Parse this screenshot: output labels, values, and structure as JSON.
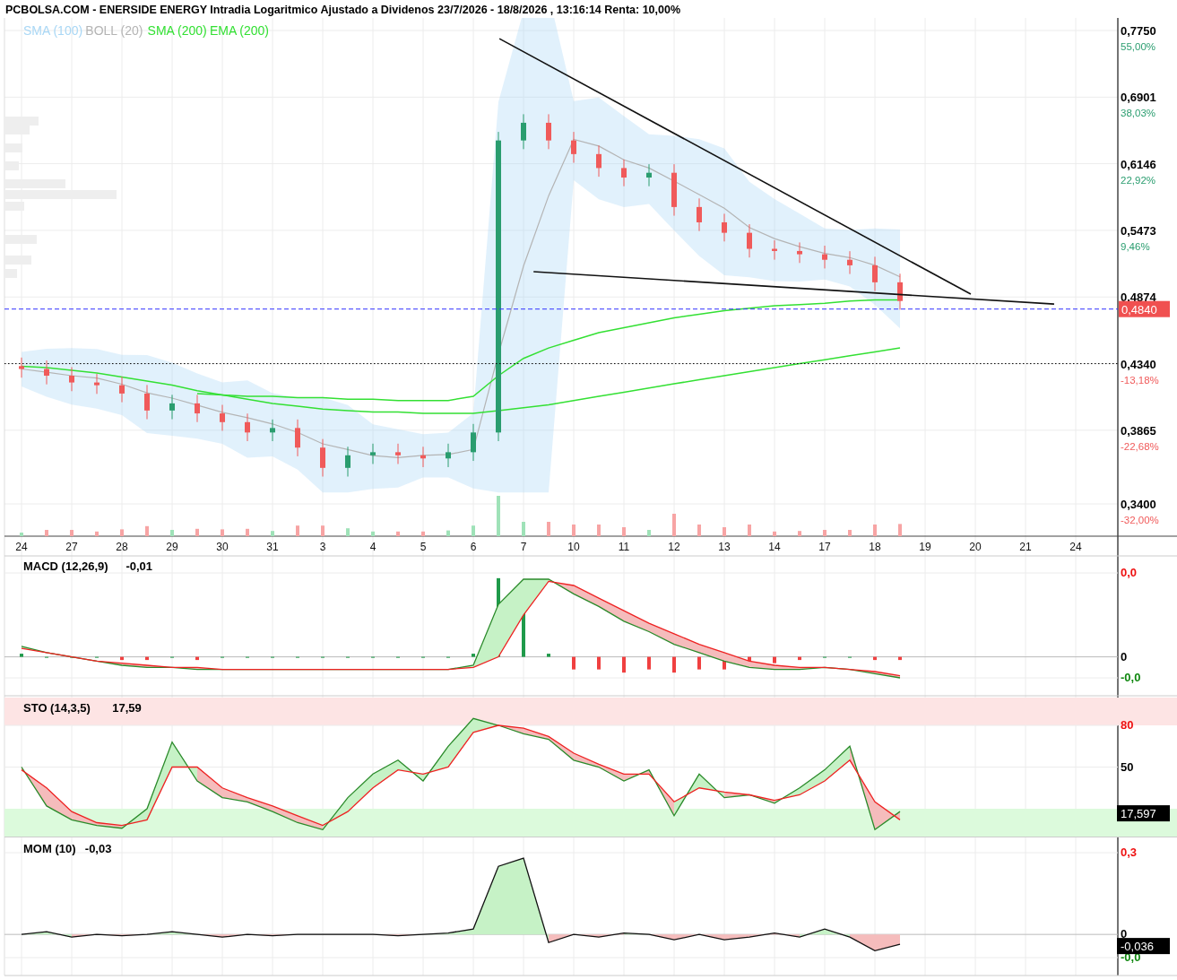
{
  "header": {
    "title": "PCBOLSA.COM - ENERSIDE ENERGY Intradia Logaritmico Ajustado a Dividenos 23/7/2026 - 18/8/2026 , 13:16:14 Renta: 10,00%"
  },
  "legend": [
    {
      "label": "SMA (100)",
      "color": "#a9d7f5"
    },
    {
      "label": "BOLL (20)",
      "color": "#b4b4b4"
    },
    {
      "label": "SMA (200)",
      "color": "#33e033"
    },
    {
      "label": "EMA (200)",
      "color": "#33e033"
    }
  ],
  "price_axis": {
    "labels": [
      "0,7750",
      "0,6901",
      "0,6146",
      "0,5473",
      "0,4874",
      "0,4340",
      "0,3865",
      "0,3400"
    ],
    "changes": [
      {
        "text": "55,00%",
        "kind": "up"
      },
      {
        "text": "38,03%",
        "kind": "up"
      },
      {
        "text": "22,92%",
        "kind": "up"
      },
      {
        "text": "9,46%",
        "kind": "up"
      },
      {
        "text": "-13,18%",
        "kind": "down"
      },
      {
        "text": "-22,68%",
        "kind": "down"
      },
      {
        "text": "-32,00%",
        "kind": "down"
      }
    ],
    "last_price": "0,4840"
  },
  "date_axis": {
    "labels": [
      "24",
      "27",
      "28",
      "29",
      "30",
      "31",
      "3",
      "4",
      "5",
      "6",
      "7",
      "10",
      "11",
      "12",
      "13",
      "14",
      "17",
      "18",
      "19",
      "20",
      "21",
      "24"
    ]
  },
  "indicator_panels": [
    {
      "kind": "macd",
      "title": "MACD (12,26,9)",
      "readout": "-0,01",
      "axis_labels": [
        {
          "text": "0,0",
          "kind": "high"
        },
        {
          "text": "0",
          "kind": "mid"
        },
        {
          "text": "-0,0",
          "kind": "low"
        }
      ]
    },
    {
      "kind": "sto",
      "title": "STO (14,3,5)",
      "readout": "17,59",
      "value_tag": "17,597",
      "axis_labels": [
        {
          "text": "80",
          "kind": "high"
        },
        {
          "text": "50",
          "kind": "mid"
        }
      ]
    },
    {
      "kind": "mom",
      "title": "MOM (10)",
      "readout": "-0,03",
      "value_tag": "-0,036",
      "axis_labels": [
        {
          "text": "0,3",
          "kind": "high"
        },
        {
          "text": "0",
          "kind": "mid"
        },
        {
          "text": "-0,0",
          "kind": "low"
        }
      ]
    }
  ]
}
